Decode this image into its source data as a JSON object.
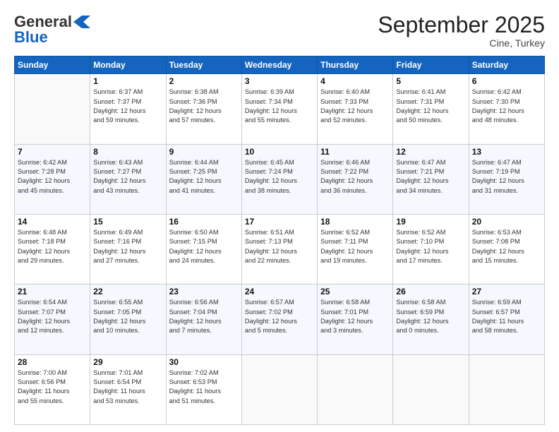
{
  "header": {
    "logo_general": "General",
    "logo_blue": "Blue",
    "month_title": "September 2025",
    "location": "Cine, Turkey"
  },
  "days_of_week": [
    "Sunday",
    "Monday",
    "Tuesday",
    "Wednesday",
    "Thursday",
    "Friday",
    "Saturday"
  ],
  "weeks": [
    [
      {
        "day": "",
        "info": ""
      },
      {
        "day": "1",
        "info": "Sunrise: 6:37 AM\nSunset: 7:37 PM\nDaylight: 12 hours\nand 59 minutes."
      },
      {
        "day": "2",
        "info": "Sunrise: 6:38 AM\nSunset: 7:36 PM\nDaylight: 12 hours\nand 57 minutes."
      },
      {
        "day": "3",
        "info": "Sunrise: 6:39 AM\nSunset: 7:34 PM\nDaylight: 12 hours\nand 55 minutes."
      },
      {
        "day": "4",
        "info": "Sunrise: 6:40 AM\nSunset: 7:33 PM\nDaylight: 12 hours\nand 52 minutes."
      },
      {
        "day": "5",
        "info": "Sunrise: 6:41 AM\nSunset: 7:31 PM\nDaylight: 12 hours\nand 50 minutes."
      },
      {
        "day": "6",
        "info": "Sunrise: 6:42 AM\nSunset: 7:30 PM\nDaylight: 12 hours\nand 48 minutes."
      }
    ],
    [
      {
        "day": "7",
        "info": "Sunrise: 6:42 AM\nSunset: 7:28 PM\nDaylight: 12 hours\nand 45 minutes."
      },
      {
        "day": "8",
        "info": "Sunrise: 6:43 AM\nSunset: 7:27 PM\nDaylight: 12 hours\nand 43 minutes."
      },
      {
        "day": "9",
        "info": "Sunrise: 6:44 AM\nSunset: 7:25 PM\nDaylight: 12 hours\nand 41 minutes."
      },
      {
        "day": "10",
        "info": "Sunrise: 6:45 AM\nSunset: 7:24 PM\nDaylight: 12 hours\nand 38 minutes."
      },
      {
        "day": "11",
        "info": "Sunrise: 6:46 AM\nSunset: 7:22 PM\nDaylight: 12 hours\nand 36 minutes."
      },
      {
        "day": "12",
        "info": "Sunrise: 6:47 AM\nSunset: 7:21 PM\nDaylight: 12 hours\nand 34 minutes."
      },
      {
        "day": "13",
        "info": "Sunrise: 6:47 AM\nSunset: 7:19 PM\nDaylight: 12 hours\nand 31 minutes."
      }
    ],
    [
      {
        "day": "14",
        "info": "Sunrise: 6:48 AM\nSunset: 7:18 PM\nDaylight: 12 hours\nand 29 minutes."
      },
      {
        "day": "15",
        "info": "Sunrise: 6:49 AM\nSunset: 7:16 PM\nDaylight: 12 hours\nand 27 minutes."
      },
      {
        "day": "16",
        "info": "Sunrise: 6:50 AM\nSunset: 7:15 PM\nDaylight: 12 hours\nand 24 minutes."
      },
      {
        "day": "17",
        "info": "Sunrise: 6:51 AM\nSunset: 7:13 PM\nDaylight: 12 hours\nand 22 minutes."
      },
      {
        "day": "18",
        "info": "Sunrise: 6:52 AM\nSunset: 7:11 PM\nDaylight: 12 hours\nand 19 minutes."
      },
      {
        "day": "19",
        "info": "Sunrise: 6:52 AM\nSunset: 7:10 PM\nDaylight: 12 hours\nand 17 minutes."
      },
      {
        "day": "20",
        "info": "Sunrise: 6:53 AM\nSunset: 7:08 PM\nDaylight: 12 hours\nand 15 minutes."
      }
    ],
    [
      {
        "day": "21",
        "info": "Sunrise: 6:54 AM\nSunset: 7:07 PM\nDaylight: 12 hours\nand 12 minutes."
      },
      {
        "day": "22",
        "info": "Sunrise: 6:55 AM\nSunset: 7:05 PM\nDaylight: 12 hours\nand 10 minutes."
      },
      {
        "day": "23",
        "info": "Sunrise: 6:56 AM\nSunset: 7:04 PM\nDaylight: 12 hours\nand 7 minutes."
      },
      {
        "day": "24",
        "info": "Sunrise: 6:57 AM\nSunset: 7:02 PM\nDaylight: 12 hours\nand 5 minutes."
      },
      {
        "day": "25",
        "info": "Sunrise: 6:58 AM\nSunset: 7:01 PM\nDaylight: 12 hours\nand 3 minutes."
      },
      {
        "day": "26",
        "info": "Sunrise: 6:58 AM\nSunset: 6:59 PM\nDaylight: 12 hours\nand 0 minutes."
      },
      {
        "day": "27",
        "info": "Sunrise: 6:59 AM\nSunset: 6:57 PM\nDaylight: 11 hours\nand 58 minutes."
      }
    ],
    [
      {
        "day": "28",
        "info": "Sunrise: 7:00 AM\nSunset: 6:56 PM\nDaylight: 11 hours\nand 55 minutes."
      },
      {
        "day": "29",
        "info": "Sunrise: 7:01 AM\nSunset: 6:54 PM\nDaylight: 11 hours\nand 53 minutes."
      },
      {
        "day": "30",
        "info": "Sunrise: 7:02 AM\nSunset: 6:53 PM\nDaylight: 11 hours\nand 51 minutes."
      },
      {
        "day": "",
        "info": ""
      },
      {
        "day": "",
        "info": ""
      },
      {
        "day": "",
        "info": ""
      },
      {
        "day": "",
        "info": ""
      }
    ]
  ]
}
